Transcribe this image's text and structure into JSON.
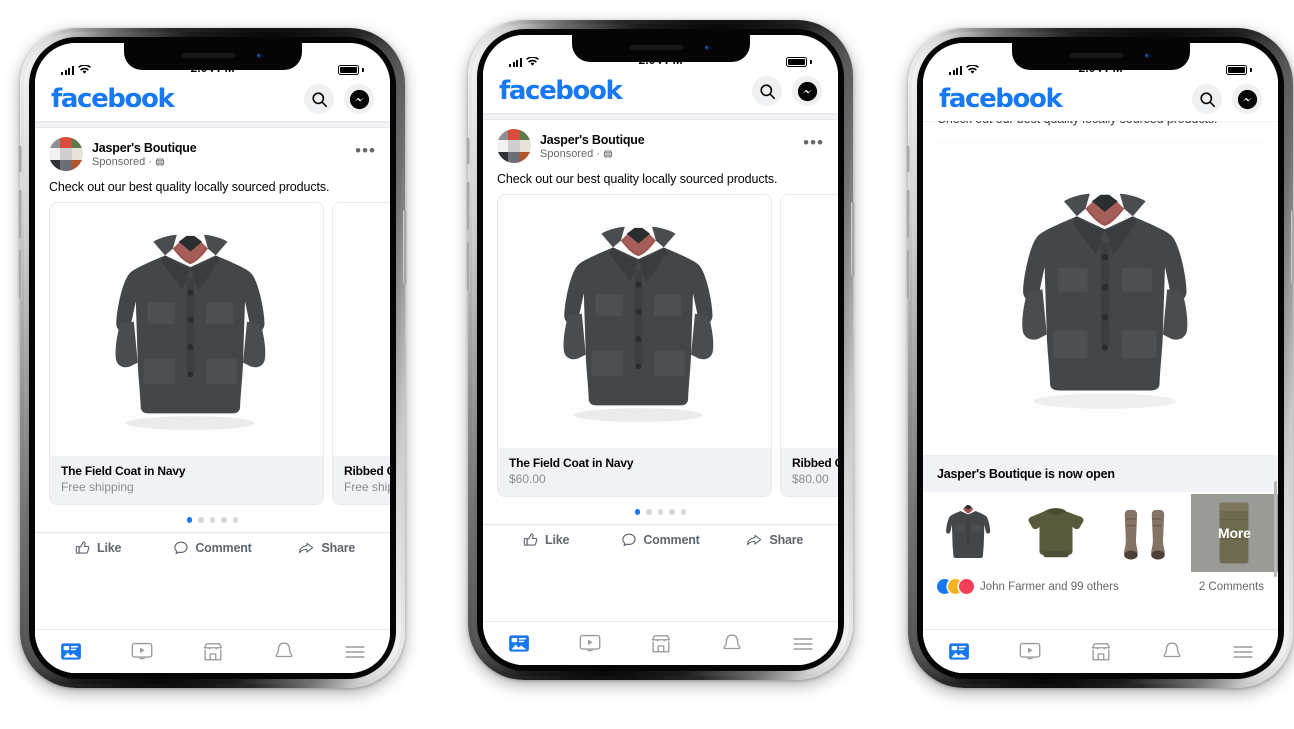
{
  "mockup": {
    "device": "iphone-x",
    "count": 3,
    "brand_color": "#1778F2"
  },
  "status_bar": {
    "time": "2:04 PM",
    "signal_icon": "cellular-bars-icon",
    "wifi_icon": "wifi-icon",
    "battery_icon": "battery-full-icon"
  },
  "header": {
    "logo": "facebook",
    "search_icon": "search-icon",
    "messenger_icon": "messenger-icon"
  },
  "post": {
    "page_name": "Jasper's Boutique",
    "sponsored_label": "Sponsored",
    "separator": "·",
    "globe_icon": "globe-icon",
    "menu_icon": "more-options-icon",
    "body_text": "Check out our best quality locally sourced products."
  },
  "carousel": {
    "dots_total": 5,
    "active_dot": 1,
    "cards_variant_a": [
      {
        "title": "The Field Coat in Navy",
        "subtitle": "Free shipping",
        "image": "field-coat-grey"
      },
      {
        "title": "Ribbed Crew Sweater",
        "subtitle": "Free shipping",
        "image": "sweater-olive"
      }
    ],
    "cards_variant_b": [
      {
        "title": "The Field Coat in Navy",
        "subtitle": "$60.00",
        "image": "field-coat-grey"
      },
      {
        "title": "Ribbed Crew Sweater",
        "subtitle": "$80.00",
        "image": "sweater-olive"
      }
    ]
  },
  "action_bar": {
    "like_label": "Like",
    "like_icon": "thumbs-up-icon",
    "comment_label": "Comment",
    "comment_icon": "comment-bubble-icon",
    "share_label": "Share",
    "share_icon": "share-arrow-icon"
  },
  "tab_bar": {
    "items": [
      {
        "name": "news-feed",
        "icon": "news-feed-icon",
        "active": true
      },
      {
        "name": "watch",
        "icon": "video-play-icon",
        "active": false
      },
      {
        "name": "marketplace",
        "icon": "storefront-icon",
        "active": false
      },
      {
        "name": "notifications",
        "icon": "bell-icon",
        "active": false
      },
      {
        "name": "menu",
        "icon": "hamburger-menu-icon",
        "active": false
      }
    ]
  },
  "phone3": {
    "promo_text": "Jasper's Boutique is now open",
    "more_label": "More",
    "thumbnails": [
      {
        "name": "field-coat-thumb",
        "image": "field-coat-grey"
      },
      {
        "name": "sweater-thumb",
        "image": "sweater-olive"
      },
      {
        "name": "boots-thumb",
        "image": "boots-brown"
      },
      {
        "name": "pants-thumb",
        "image": "pants-olive",
        "overlay": "More"
      }
    ],
    "reactions_count": "100",
    "reactions_label": "John Farmer and 99 others",
    "comments_label": "2 Comments"
  }
}
